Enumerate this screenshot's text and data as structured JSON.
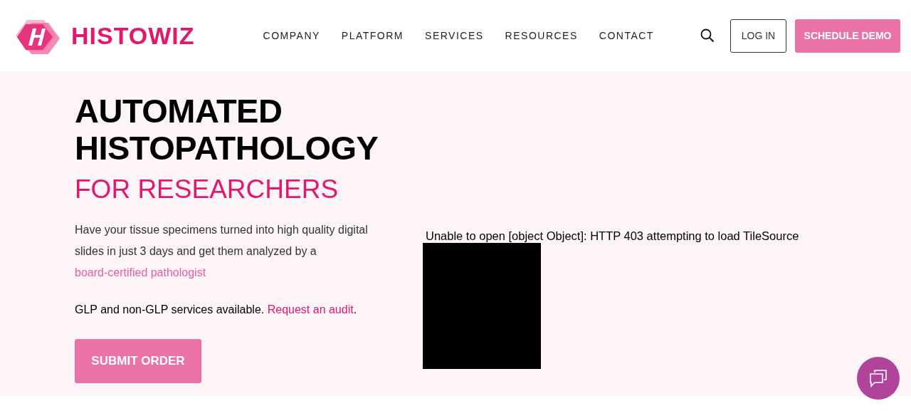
{
  "header": {
    "logo_text": "HISTOWIZ",
    "nav": [
      {
        "label": "COMPANY"
      },
      {
        "label": "PLATFORM"
      },
      {
        "label": "SERVICES"
      },
      {
        "label": "RESOURCES"
      },
      {
        "label": "CONTACT"
      }
    ],
    "login": "LOG IN",
    "cta": "SCHEDULE DEMO"
  },
  "hero": {
    "title_lines": [
      "AUTOMATED",
      "HISTOPATHOLOGY"
    ],
    "subtitle": "FOR RESEARCHERS",
    "intro": "Have your tissue specimens turned into high quality digital slides in just 3 days and get them analyzed by a",
    "intro_link": "board-certified pathologist",
    "glp_text": "GLP and non-GLP services available.",
    "glp_link": "Request an audit",
    "glp_end": ".",
    "submit": "SUBMIT ORDER"
  },
  "viewer": {
    "error": "Unable to open [object Object]: HTTP 403 attempting to load TileSource"
  }
}
